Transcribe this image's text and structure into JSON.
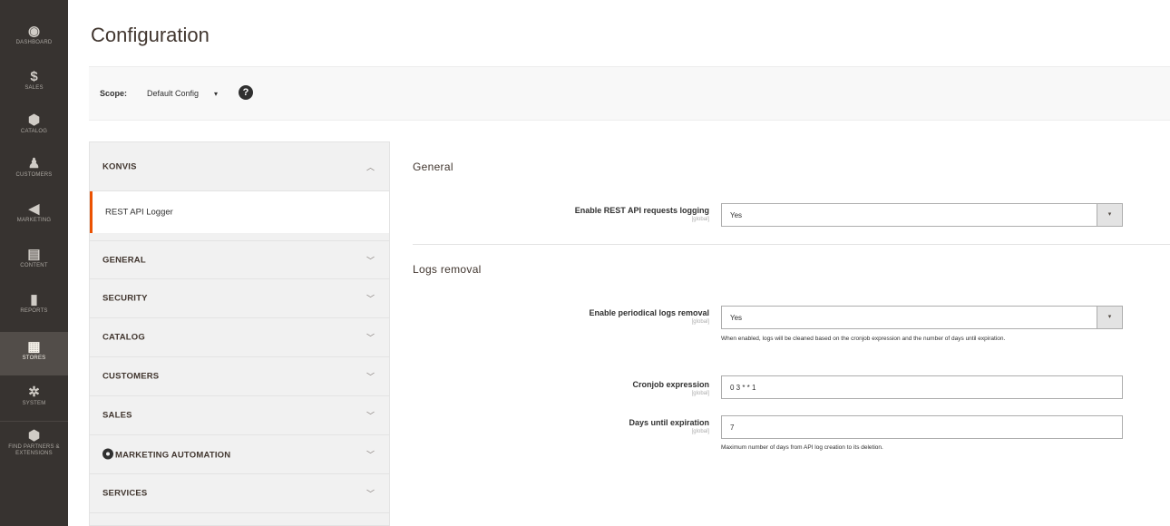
{
  "admin_menu": {
    "items": [
      {
        "icon": "dashboard-icon",
        "glyph": "◉",
        "label": "Dashboard"
      },
      {
        "icon": "dollar-icon",
        "glyph": "$",
        "label": "Sales"
      },
      {
        "icon": "cube-icon",
        "glyph": "⬢",
        "label": "Catalog"
      },
      {
        "icon": "person-icon",
        "glyph": "♟",
        "label": "Customers"
      },
      {
        "icon": "megaphone-icon",
        "glyph": "◀",
        "label": "Marketing"
      },
      {
        "icon": "content-icon",
        "glyph": "▤",
        "label": "Content"
      },
      {
        "icon": "bar-chart-icon",
        "glyph": "▮",
        "label": "Reports"
      },
      {
        "icon": "store-icon",
        "glyph": "▦",
        "label": "Stores"
      },
      {
        "icon": "gear-icon",
        "glyph": "✲",
        "label": "System"
      },
      {
        "icon": "extensions-icon",
        "glyph": "⬢",
        "label": "Find Partners & Extensions"
      }
    ],
    "active": "Stores"
  },
  "page": {
    "title": "Configuration"
  },
  "scope": {
    "label": "Scope:",
    "value": "Default Config",
    "caret": "▾",
    "help": "?"
  },
  "config_nav": {
    "sections": [
      {
        "title": "KONVIS",
        "chevron": "︿"
      },
      {
        "title": "GENERAL",
        "chevron": "﹀"
      },
      {
        "title": "SECURITY",
        "chevron": "﹀"
      },
      {
        "title": "CATALOG",
        "chevron": "﹀"
      },
      {
        "title": "CUSTOMERS",
        "chevron": "﹀"
      },
      {
        "title": "SALES",
        "chevron": "﹀"
      },
      {
        "title": "MARKETING AUTOMATION",
        "chevron": "﹀"
      },
      {
        "title": "SERVICES",
        "chevron": "﹀"
      }
    ],
    "active_item": "REST API Logger"
  },
  "form": {
    "general": {
      "heading": "General",
      "enable_logging": {
        "label": "Enable REST API requests logging",
        "scope": "[global]",
        "value": "Yes"
      }
    },
    "logs_removal": {
      "heading": "Logs removal",
      "enable_removal": {
        "label": "Enable periodical logs removal",
        "scope": "[global]",
        "value": "Yes",
        "note": "When enabled, logs will be cleaned based on the cronjob expression and the number of days until expiration."
      },
      "cronjob": {
        "label": "Cronjob expression",
        "scope": "[global]",
        "value": "0 3 * * 1"
      },
      "days": {
        "label": "Days until expiration",
        "scope": "[global]",
        "value": "7",
        "note": "Maximum number of days from API log creation to its deletion."
      }
    }
  },
  "colors": {
    "menu_bg": "#373330",
    "active_accent": "#eb5202",
    "nav_bg": "#f1f1f1"
  }
}
